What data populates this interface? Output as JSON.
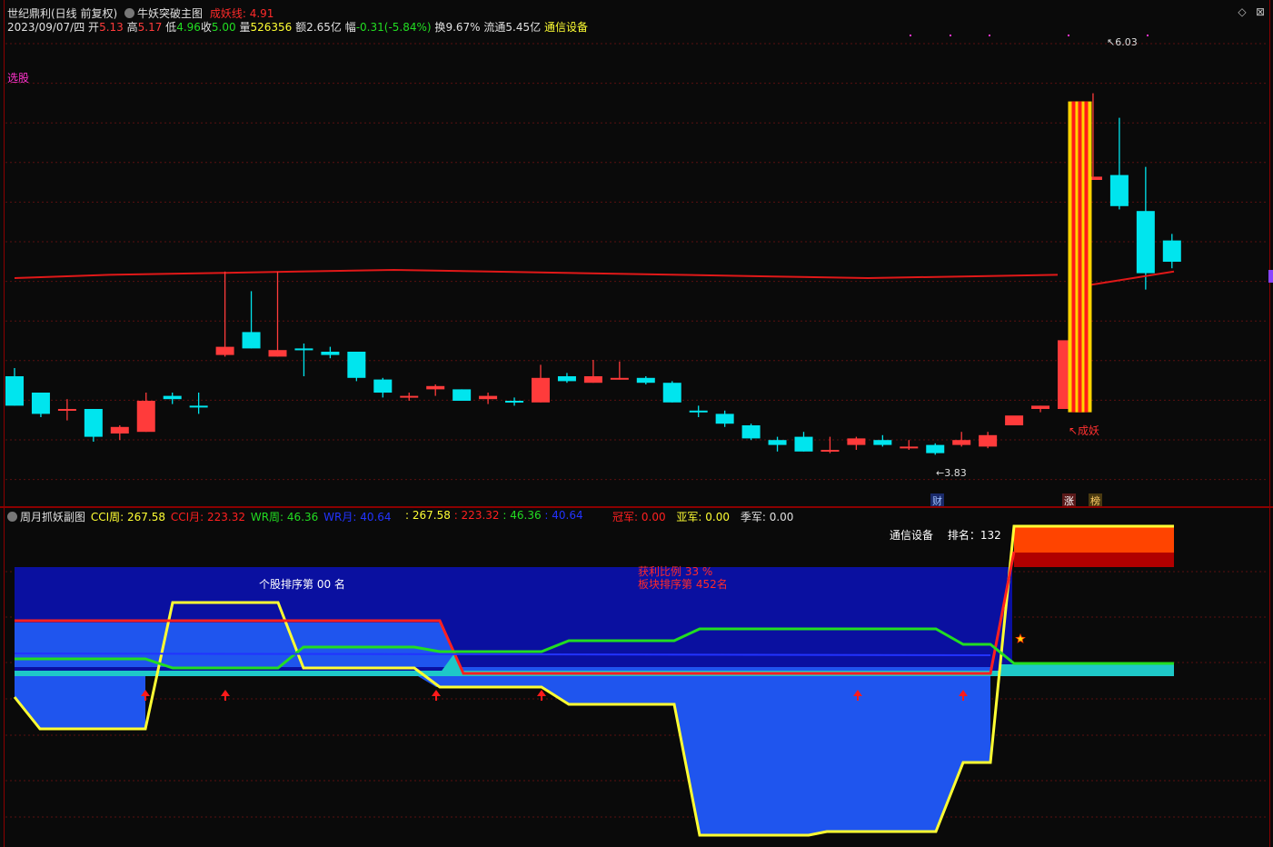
{
  "main_header": {
    "stock_title": "世纪鼎利(日线 前复权)",
    "indicator_name": "牛妖突破主图",
    "line_label": "成妖线: 4.91",
    "date": "2023/09/07/四",
    "open_label": "开",
    "open_value": "5.13",
    "high_label": "高",
    "high_value": "5.17",
    "low_label": "低",
    "low_value": "4.96",
    "close_label": "收",
    "close_value": "5.00",
    "volume_label": "量",
    "volume_value": "526356",
    "amount_label": "额",
    "amount_value": "2.65亿",
    "change_label": "幅",
    "change_value": "-0.31(-5.84%)",
    "turnover_label": "换",
    "turnover_value": "9.67%",
    "float_label": "流通",
    "float_value": "5.45亿",
    "sector": "通信设备"
  },
  "left_label": "选股",
  "annotations": {
    "high_price": "6.03",
    "low_price": "3.83",
    "cheng_yao": "↖成妖"
  },
  "bottom_tags": {
    "cai": "财",
    "zhang": "涨",
    "bang": "榜"
  },
  "sub_header": {
    "title": "周月抓妖副图",
    "cci_week_label": "CCI周:",
    "cci_week_value": "267.58",
    "cci_month_label": "CCI月:",
    "cci_month_value": "223.32",
    "wr_week_label": "WR周:",
    "wr_week_value": "46.36",
    "wr_month_label": "WR月:",
    "wr_month_value": "40.64",
    "v1": ": 267.58",
    "v2": ": 223.32",
    "v3": ": 46.36",
    "v4": ": 40.64",
    "champion_label": "冠军:",
    "champion_value": "0.00",
    "runner_label": "亚军:",
    "runner_value": "0.00",
    "third_label": "季军:",
    "third_value": "0.00"
  },
  "sub_text": {
    "sector": "通信设备",
    "rank_label": "排名：",
    "rank_value": "132",
    "stock_rank": "个股排序第 00 名",
    "profit_ratio": "获利比例 33 %",
    "sector_rank": "板块排序第 452名"
  },
  "colors": {
    "up": "#ff3b3b",
    "down": "#00e5ee",
    "ma_line": "#e01818",
    "cci_week": "#ffff33",
    "cci_month": "#ff2020",
    "wr_week": "#22dd22",
    "wr_month": "#2233ff"
  },
  "chart_data": {
    "type": "candlestick",
    "price_range": [
      3.6,
      6.4
    ],
    "candles": [
      {
        "o": 4.3,
        "h": 4.35,
        "c": 4.12,
        "l": 4.12
      },
      {
        "o": 4.2,
        "h": 4.2,
        "c": 4.07,
        "l": 4.05
      },
      {
        "o": 4.1,
        "h": 4.16,
        "c": 4.1,
        "l": 4.03
      },
      {
        "o": 4.1,
        "h": 4.1,
        "c": 3.93,
        "l": 3.9
      },
      {
        "o": 3.95,
        "h": 4.0,
        "c": 3.99,
        "l": 3.91
      },
      {
        "o": 3.96,
        "h": 4.2,
        "c": 4.15,
        "l": 3.96
      },
      {
        "o": 4.18,
        "h": 4.2,
        "c": 4.16,
        "l": 4.13
      },
      {
        "o": 4.12,
        "h": 4.2,
        "c": 4.11,
        "l": 4.07
      },
      {
        "o": 4.43,
        "h": 4.94,
        "c": 4.48,
        "l": 4.42
      },
      {
        "o": 4.57,
        "h": 4.82,
        "c": 4.47,
        "l": 4.47
      },
      {
        "o": 4.42,
        "h": 4.94,
        "c": 4.46,
        "l": 4.42
      },
      {
        "o": 4.47,
        "h": 4.5,
        "c": 4.46,
        "l": 4.3
      },
      {
        "o": 4.45,
        "h": 4.48,
        "c": 4.43,
        "l": 4.41
      },
      {
        "o": 4.45,
        "h": 4.45,
        "c": 4.29,
        "l": 4.27
      },
      {
        "o": 4.28,
        "h": 4.29,
        "c": 4.2,
        "l": 4.17
      },
      {
        "o": 4.17,
        "h": 4.2,
        "c": 4.18,
        "l": 4.15
      },
      {
        "o": 4.22,
        "h": 4.25,
        "c": 4.24,
        "l": 4.18
      },
      {
        "o": 4.22,
        "h": 4.22,
        "c": 4.15,
        "l": 4.15
      },
      {
        "o": 4.16,
        "h": 4.2,
        "c": 4.18,
        "l": 4.13
      },
      {
        "o": 4.15,
        "h": 4.17,
        "c": 4.14,
        "l": 4.12
      },
      {
        "o": 4.14,
        "h": 4.37,
        "c": 4.29,
        "l": 4.14
      },
      {
        "o": 4.3,
        "h": 4.32,
        "c": 4.27,
        "l": 4.26
      },
      {
        "o": 4.26,
        "h": 4.4,
        "c": 4.3,
        "l": 4.26
      },
      {
        "o": 4.29,
        "h": 4.39,
        "c": 4.29,
        "l": 4.28
      },
      {
        "o": 4.29,
        "h": 4.3,
        "c": 4.26,
        "l": 4.25
      },
      {
        "o": 4.26,
        "h": 4.27,
        "c": 4.14,
        "l": 4.14
      },
      {
        "o": 4.09,
        "h": 4.12,
        "c": 4.08,
        "l": 4.05
      },
      {
        "o": 4.07,
        "h": 4.09,
        "c": 4.01,
        "l": 3.99
      },
      {
        "o": 4.0,
        "h": 4.01,
        "c": 3.92,
        "l": 3.91
      },
      {
        "o": 3.91,
        "h": 3.93,
        "c": 3.88,
        "l": 3.84
      },
      {
        "o": 3.93,
        "h": 3.96,
        "c": 3.84,
        "l": 3.84
      },
      {
        "o": 3.85,
        "h": 3.93,
        "c": 3.85,
        "l": 3.83
      },
      {
        "o": 3.88,
        "h": 3.93,
        "c": 3.92,
        "l": 3.85
      },
      {
        "o": 3.91,
        "h": 3.94,
        "c": 3.88,
        "l": 3.87
      },
      {
        "o": 3.87,
        "h": 3.91,
        "c": 3.87,
        "l": 3.85
      },
      {
        "o": 3.88,
        "h": 3.89,
        "c": 3.83,
        "l": 3.82
      },
      {
        "o": 3.88,
        "h": 3.96,
        "c": 3.91,
        "l": 3.87
      },
      {
        "o": 3.87,
        "h": 3.96,
        "c": 3.94,
        "l": 3.86
      },
      {
        "o": 4.0,
        "h": 4.05,
        "c": 4.06,
        "l": 4.0
      },
      {
        "o": 4.1,
        "h": 4.12,
        "c": 4.12,
        "l": 4.08
      },
      {
        "o": 4.1,
        "h": 4.5,
        "c": 4.52,
        "l": 4.1
      },
      {
        "o": 5.5,
        "h": 6.03,
        "c": 5.52,
        "l": 5.52
      },
      {
        "o": 5.53,
        "h": 5.88,
        "c": 5.34,
        "l": 5.32
      },
      {
        "o": 5.31,
        "h": 5.58,
        "c": 4.93,
        "l": 4.83
      },
      {
        "o": 5.13,
        "h": 5.17,
        "c": 5.0,
        "l": 4.96
      }
    ],
    "cheng_yao_line": [
      4.9,
      4.92,
      4.93,
      4.94,
      4.95,
      4.94,
      4.93,
      4.92,
      4.91,
      4.9,
      4.91,
      4.92
    ]
  }
}
